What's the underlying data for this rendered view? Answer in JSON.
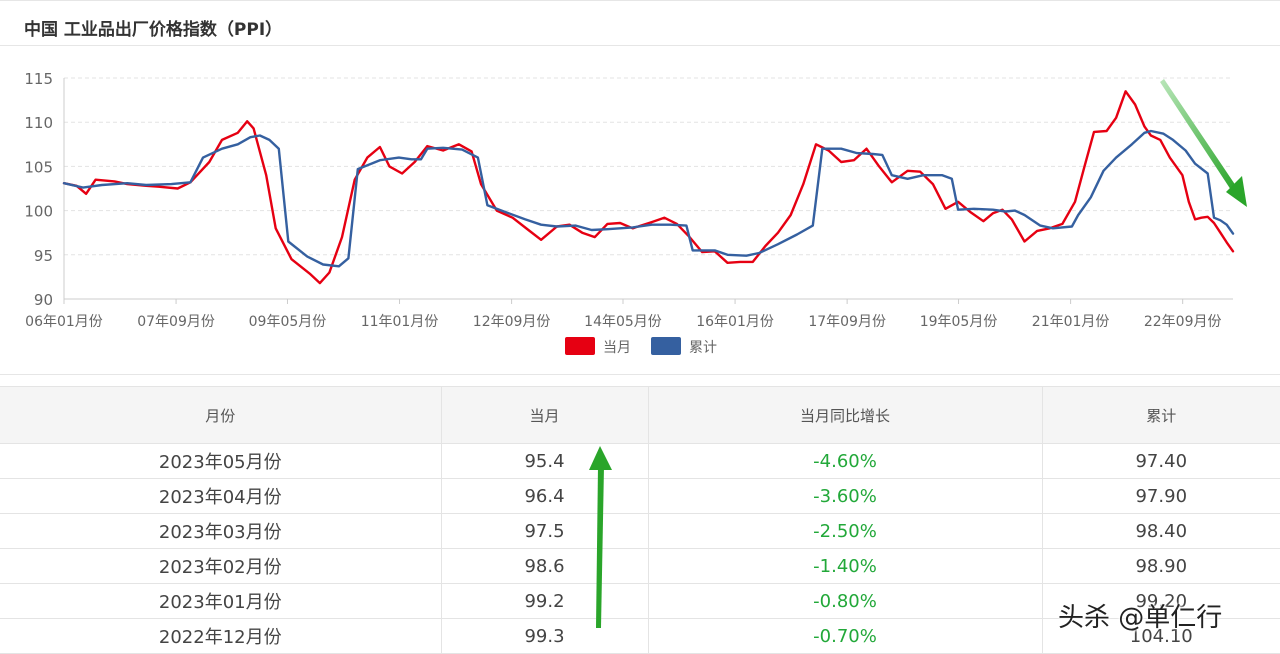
{
  "header": {
    "title": "中国 工业品出厂价格指数（PPI）"
  },
  "chart_data": {
    "type": "line",
    "ylim": [
      90,
      115
    ],
    "yticks": [
      90,
      95,
      100,
      105,
      110,
      115
    ],
    "x_range": [
      2006.0,
      2023.42
    ],
    "xticks": [
      {
        "label": "06年01月份",
        "x": 2006.0
      },
      {
        "label": "07年09月份",
        "x": 2007.67
      },
      {
        "label": "09年05月份",
        "x": 2009.33
      },
      {
        "label": "11年01月份",
        "x": 2011.0
      },
      {
        "label": "12年09月份",
        "x": 2012.67
      },
      {
        "label": "14年05月份",
        "x": 2014.33
      },
      {
        "label": "16年01月份",
        "x": 2016.0
      },
      {
        "label": "17年09月份",
        "x": 2017.67
      },
      {
        "label": "19年05月份",
        "x": 2019.33
      },
      {
        "label": "21年01月份",
        "x": 2021.0
      },
      {
        "label": "22年09月份",
        "x": 2022.67
      }
    ],
    "grid": true,
    "legend": "bottom-center",
    "series": [
      {
        "name": "当月",
        "color": "#e60012",
        "points": [
          [
            2006.0,
            103.1
          ],
          [
            2006.2,
            102.8
          ],
          [
            2006.35,
            101.9
          ],
          [
            2006.5,
            103.5
          ],
          [
            2006.8,
            103.3
          ],
          [
            2007.0,
            103.0
          ],
          [
            2007.3,
            102.8
          ],
          [
            2007.5,
            102.7
          ],
          [
            2007.8,
            102.5
          ],
          [
            2008.0,
            103.2
          ],
          [
            2008.3,
            105.5
          ],
          [
            2008.5,
            108.0
          ],
          [
            2008.75,
            108.8
          ],
          [
            2008.9,
            110.1
          ],
          [
            2009.0,
            109.3
          ],
          [
            2009.2,
            104.0
          ],
          [
            2009.35,
            98.0
          ],
          [
            2009.6,
            94.5
          ],
          [
            2009.9,
            92.8
          ],
          [
            2010.05,
            91.8
          ],
          [
            2010.2,
            93.0
          ],
          [
            2010.4,
            97.0
          ],
          [
            2010.6,
            103.5
          ],
          [
            2010.8,
            106.0
          ],
          [
            2011.0,
            107.2
          ],
          [
            2011.15,
            105.0
          ],
          [
            2011.35,
            104.2
          ],
          [
            2011.55,
            105.5
          ],
          [
            2011.75,
            107.3
          ],
          [
            2012.0,
            106.8
          ],
          [
            2012.25,
            107.5
          ],
          [
            2012.45,
            106.7
          ],
          [
            2012.6,
            103.0
          ],
          [
            2012.85,
            100.0
          ],
          [
            2013.1,
            99.2
          ],
          [
            2013.35,
            97.8
          ],
          [
            2013.55,
            96.7
          ],
          [
            2013.8,
            98.2
          ],
          [
            2014.0,
            98.4
          ],
          [
            2014.2,
            97.5
          ],
          [
            2014.4,
            97.0
          ],
          [
            2014.6,
            98.5
          ],
          [
            2014.8,
            98.6
          ],
          [
            2015.0,
            98.0
          ],
          [
            2015.3,
            98.7
          ],
          [
            2015.5,
            99.2
          ],
          [
            2015.7,
            98.5
          ],
          [
            2015.9,
            97.0
          ],
          [
            2016.1,
            95.3
          ],
          [
            2016.3,
            95.4
          ],
          [
            2016.5,
            94.1
          ],
          [
            2016.7,
            94.2
          ],
          [
            2016.9,
            94.2
          ],
          [
            2017.1,
            96.0
          ],
          [
            2017.3,
            97.5
          ],
          [
            2017.5,
            99.5
          ],
          [
            2017.7,
            103.0
          ],
          [
            2017.9,
            107.5
          ],
          [
            2018.1,
            106.8
          ],
          [
            2018.3,
            105.5
          ],
          [
            2018.5,
            105.7
          ],
          [
            2018.7,
            107.0
          ],
          [
            2018.9,
            105.0
          ],
          [
            2019.1,
            103.2
          ],
          [
            2019.35,
            104.5
          ],
          [
            2019.55,
            104.4
          ],
          [
            2019.75,
            103.0
          ],
          [
            2019.95,
            100.2
          ],
          [
            2020.15,
            101.0
          ],
          [
            2020.35,
            99.8
          ],
          [
            2020.55,
            98.8
          ],
          [
            2020.7,
            99.7
          ],
          [
            2020.85,
            100.1
          ],
          [
            2021.0,
            99.0
          ],
          [
            2021.2,
            96.5
          ],
          [
            2021.4,
            97.7
          ],
          [
            2021.6,
            98.0
          ],
          [
            2021.8,
            98.5
          ],
          [
            2022.0,
            101.0
          ],
          [
            2022.15,
            105.0
          ],
          [
            2022.3,
            108.9
          ],
          [
            2022.5,
            109.0
          ],
          [
            2022.65,
            110.5
          ],
          [
            2022.8,
            113.5
          ],
          [
            2022.95,
            112.0
          ],
          [
            2023.1,
            109.5
          ],
          [
            2023.2,
            108.5
          ],
          [
            2023.35,
            108.0
          ],
          [
            2023.5,
            106.0
          ],
          [
            2023.7,
            104.0
          ],
          [
            2023.8,
            101.0
          ],
          [
            2023.9,
            99.0
          ],
          [
            2024.0,
            99.2
          ],
          [
            2024.1,
            99.3
          ],
          [
            2024.2,
            98.6
          ],
          [
            2024.3,
            97.5
          ],
          [
            2024.4,
            96.4
          ],
          [
            2024.5,
            95.4
          ]
        ]
      },
      {
        "name": "累计",
        "color": "#3560a0",
        "points": [
          [
            2006.0,
            103.1
          ],
          [
            2006.3,
            102.6
          ],
          [
            2006.6,
            102.9
          ],
          [
            2007.0,
            103.1
          ],
          [
            2007.3,
            102.9
          ],
          [
            2007.7,
            103.0
          ],
          [
            2008.0,
            103.2
          ],
          [
            2008.2,
            106.0
          ],
          [
            2008.5,
            107.0
          ],
          [
            2008.75,
            107.5
          ],
          [
            2008.95,
            108.3
          ],
          [
            2009.1,
            108.5
          ],
          [
            2009.25,
            108.0
          ],
          [
            2009.4,
            107.0
          ],
          [
            2009.55,
            96.5
          ],
          [
            2009.85,
            94.8
          ],
          [
            2010.1,
            93.9
          ],
          [
            2010.35,
            93.7
          ],
          [
            2010.5,
            94.6
          ],
          [
            2010.65,
            104.7
          ],
          [
            2011.0,
            105.7
          ],
          [
            2011.3,
            106.0
          ],
          [
            2011.5,
            105.8
          ],
          [
            2011.65,
            105.8
          ],
          [
            2011.75,
            107.0
          ],
          [
            2012.0,
            107.1
          ],
          [
            2012.3,
            106.9
          ],
          [
            2012.55,
            106.0
          ],
          [
            2012.7,
            100.6
          ],
          [
            2013.0,
            99.8
          ],
          [
            2013.3,
            99.0
          ],
          [
            2013.55,
            98.4
          ],
          [
            2013.8,
            98.2
          ],
          [
            2014.1,
            98.3
          ],
          [
            2014.35,
            97.8
          ],
          [
            2014.6,
            97.9
          ],
          [
            2015.0,
            98.1
          ],
          [
            2015.3,
            98.4
          ],
          [
            2015.6,
            98.4
          ],
          [
            2015.85,
            98.3
          ],
          [
            2015.95,
            95.5
          ],
          [
            2016.3,
            95.5
          ],
          [
            2016.5,
            95.0
          ],
          [
            2016.8,
            94.9
          ],
          [
            2017.0,
            95.2
          ],
          [
            2017.3,
            96.2
          ],
          [
            2017.6,
            97.3
          ],
          [
            2017.85,
            98.3
          ],
          [
            2018.0,
            107.0
          ],
          [
            2018.3,
            107.0
          ],
          [
            2018.55,
            106.5
          ],
          [
            2018.8,
            106.4
          ],
          [
            2018.95,
            106.3
          ],
          [
            2019.1,
            104.0
          ],
          [
            2019.35,
            103.6
          ],
          [
            2019.6,
            104.0
          ],
          [
            2019.9,
            104.0
          ],
          [
            2020.05,
            103.6
          ],
          [
            2020.15,
            100.1
          ],
          [
            2020.4,
            100.2
          ],
          [
            2020.7,
            100.1
          ],
          [
            2020.9,
            99.9
          ],
          [
            2021.05,
            100.0
          ],
          [
            2021.2,
            99.5
          ],
          [
            2021.45,
            98.3
          ],
          [
            2021.65,
            98.0
          ],
          [
            2021.95,
            98.2
          ],
          [
            2022.05,
            99.5
          ],
          [
            2022.25,
            101.5
          ],
          [
            2022.45,
            104.5
          ],
          [
            2022.65,
            106.0
          ],
          [
            2022.9,
            107.5
          ],
          [
            2023.1,
            108.8
          ],
          [
            2023.2,
            109.0
          ],
          [
            2023.4,
            108.7
          ],
          [
            2023.55,
            108.0
          ],
          [
            2023.75,
            106.8
          ],
          [
            2023.9,
            105.3
          ],
          [
            2024.1,
            104.2
          ],
          [
            2024.2,
            99.2
          ],
          [
            2024.3,
            98.9
          ],
          [
            2024.4,
            98.4
          ],
          [
            2024.5,
            97.4
          ]
        ]
      }
    ]
  },
  "table": {
    "headers": [
      "月份",
      "当月",
      "当月同比增长",
      "累计"
    ],
    "rows": [
      [
        "2023年05月份",
        "95.4",
        "-4.60%",
        "97.40"
      ],
      [
        "2023年04月份",
        "96.4",
        "-3.60%",
        "97.90"
      ],
      [
        "2023年03月份",
        "97.5",
        "-2.50%",
        "98.40"
      ],
      [
        "2023年02月份",
        "98.6",
        "-1.40%",
        "98.90"
      ],
      [
        "2023年01月份",
        "99.2",
        "-0.80%",
        "99.20"
      ],
      [
        "2022年12月份",
        "99.3",
        "-0.70%",
        "104.10"
      ]
    ]
  },
  "annotations": {
    "arrow_color": "#2aa52a"
  },
  "watermark": "头杀 @单仁行"
}
